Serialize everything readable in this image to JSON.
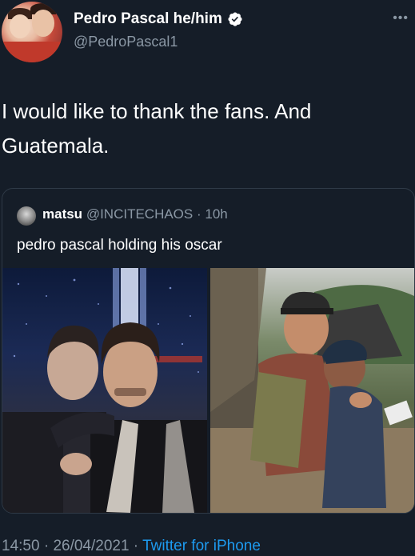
{
  "tweet": {
    "display_name": "Pedro Pascal he/him",
    "handle": "@PedroPascal1",
    "text": "I would like to thank the fans. And Guatemala.",
    "more_icon": "ellipsis-icon",
    "verified_icon": "verified-badge-icon"
  },
  "quote": {
    "display_name": "matsu",
    "handle": "@INCITECHAOS",
    "separator": " · ",
    "time": "10h",
    "text": "pedro pascal holding his oscar"
  },
  "footer": {
    "time": "14:50",
    "sep1": " · ",
    "date": "26/04/2021",
    "sep2": " · ",
    "app": "Twitter for iPhone"
  },
  "colors": {
    "background": "#151d28",
    "text": "#ffffff",
    "muted": "#8b98a5",
    "link": "#1d9bf0",
    "verified": "#1d9bf0"
  }
}
